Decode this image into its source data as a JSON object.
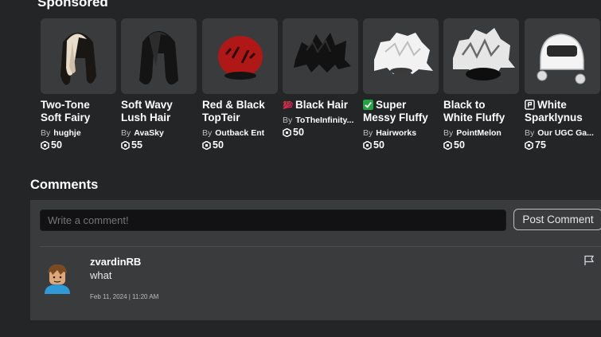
{
  "sponsored": {
    "title": "Sponsored",
    "items": [
      {
        "name_lines": [
          "Two-Tone",
          "Soft Fairy"
        ],
        "by": "By",
        "creator": "hughje",
        "price": "50"
      },
      {
        "name_lines": [
          "Soft Wavy",
          "Lush Hair"
        ],
        "by": "By",
        "creator": "AvaSky",
        "price": "55"
      },
      {
        "name_lines": [
          "Red & Black",
          "TopTeir"
        ],
        "by": "By",
        "creator": "Outback Ent",
        "price": "50"
      },
      {
        "badge": "hundred-points-emoji",
        "name_lines": [
          "Black Hair"
        ],
        "by": "By",
        "creator": "ToTheInfinity...",
        "price": "50"
      },
      {
        "badge": "check-mark-emoji",
        "name_lines": [
          "Super",
          "Messy Fluffy"
        ],
        "by": "By",
        "creator": "Hairworks",
        "price": "50"
      },
      {
        "name_lines": [
          "Black to",
          "White Fluffy"
        ],
        "by": "By",
        "creator": "PointMelon",
        "price": "50"
      },
      {
        "badge": "ugc-logo",
        "name_lines": [
          "White",
          "Sparklynus"
        ],
        "by": "By",
        "creator": "Our UGC Ga...",
        "price": "75"
      }
    ]
  },
  "comments": {
    "title": "Comments",
    "input_placeholder": "Write a comment!",
    "post_label": "Post Comment",
    "list": [
      {
        "username": "zvardinRB",
        "text": "what",
        "timestamp": "Feb 11, 2024 | 11:20 AM"
      }
    ]
  },
  "colors": {
    "background": "#232527",
    "panel": "#393b3d",
    "input": "#121215",
    "check_green": "#25a244",
    "hundred_red": "#e0245e"
  }
}
